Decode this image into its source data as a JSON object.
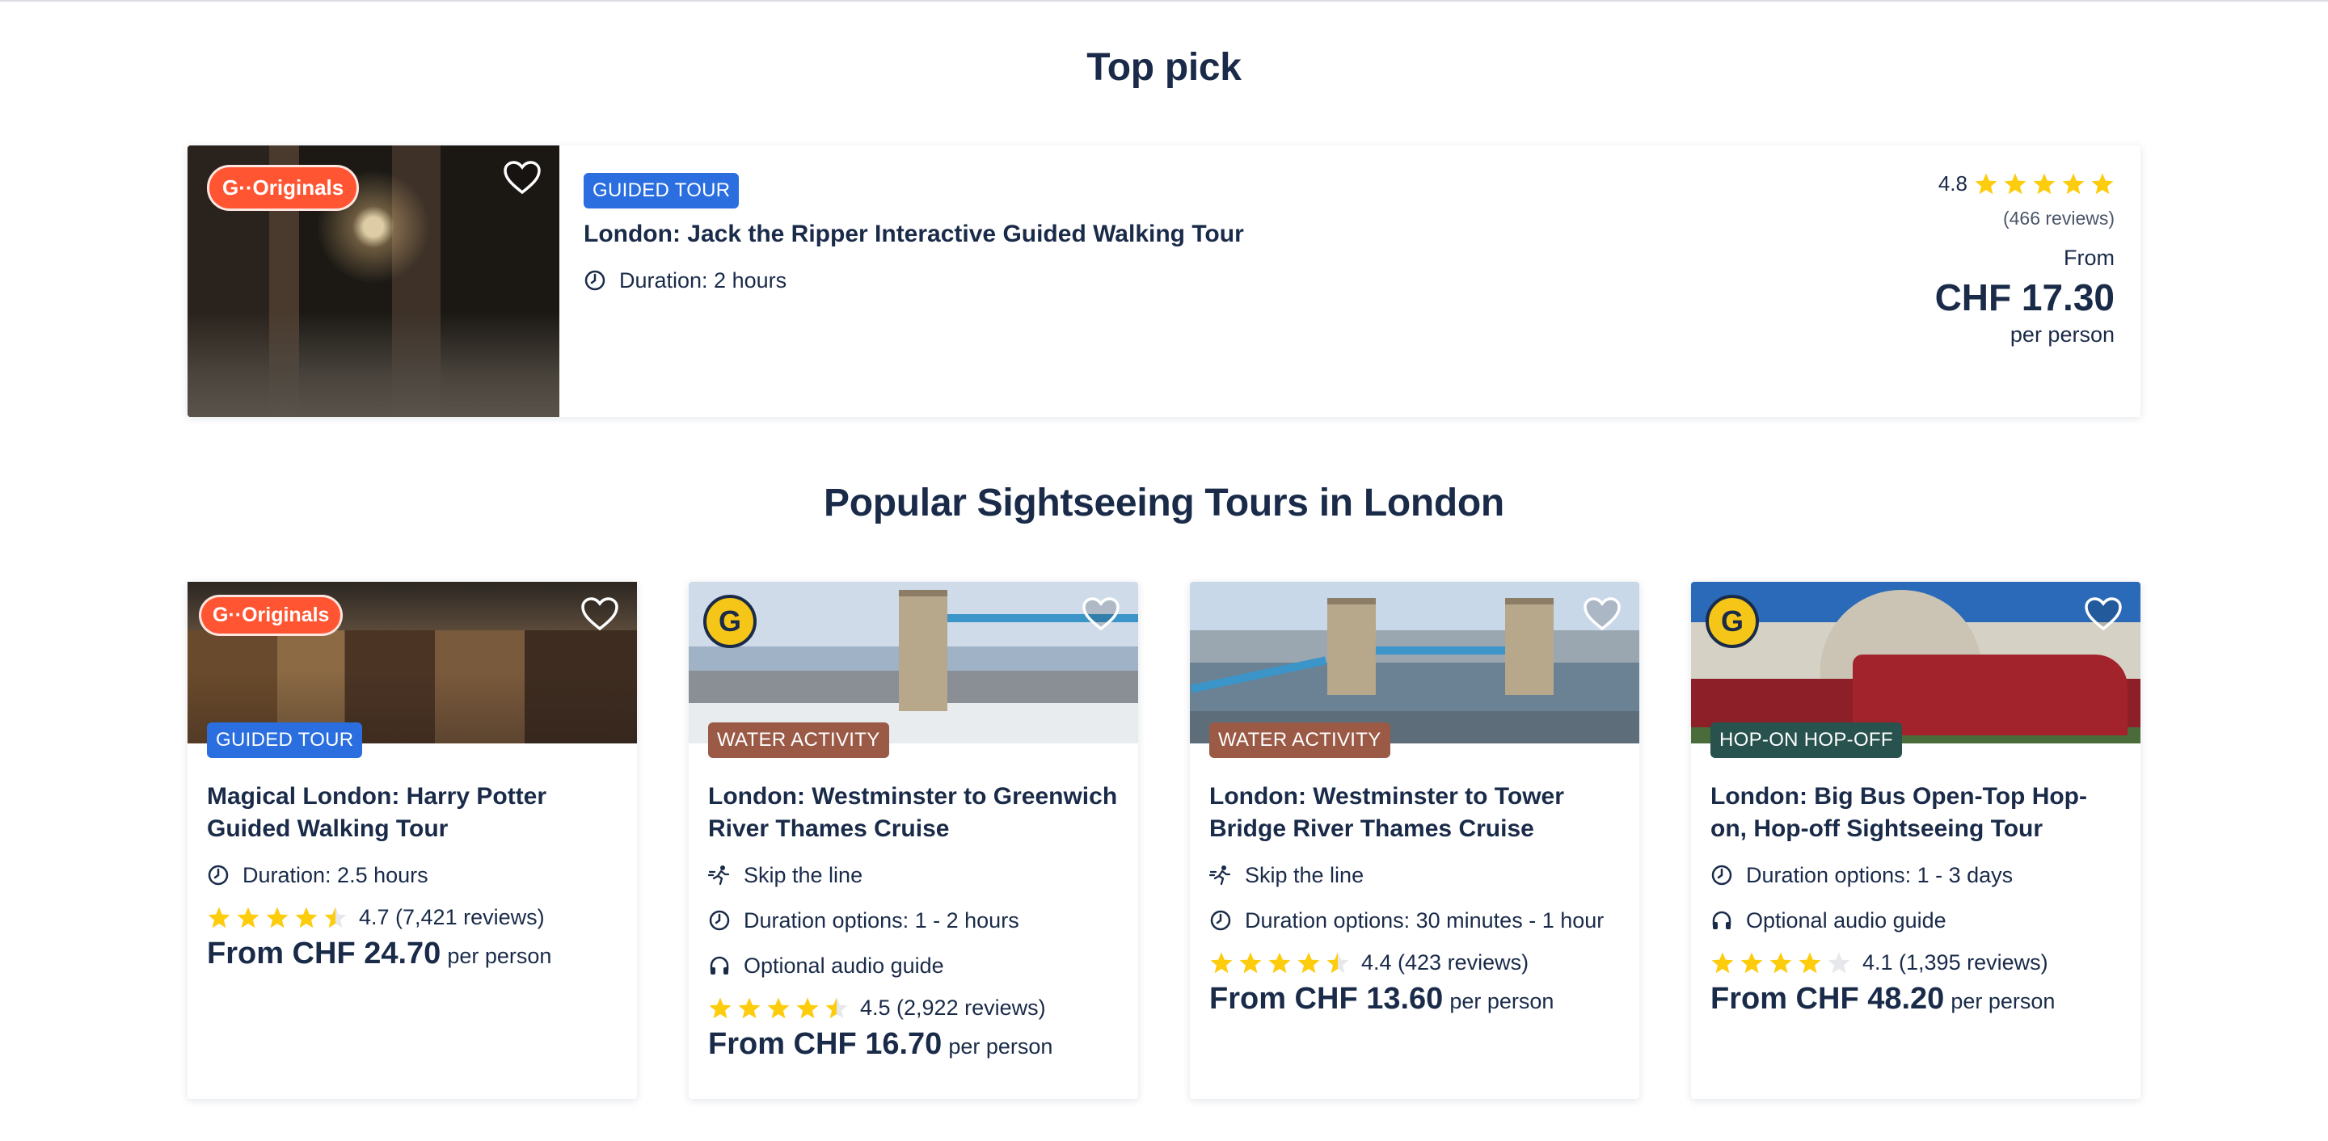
{
  "sections": {
    "top_pick_title": "Top pick",
    "popular_title": "Popular Sightseeing Tours in London"
  },
  "colors": {
    "text": "#1a2b49",
    "originals_badge": "#ff5533",
    "guided_tour": "#2a6ee0",
    "water_activity": "#9a5a46",
    "hop_on_hop_off": "#27524e",
    "star": "#fdcc0d"
  },
  "top_pick": {
    "originals_badge": "G··Originals",
    "category": "GUIDED TOUR",
    "title": "London: Jack the Ripper Interactive Guided Walking Tour",
    "duration_icon": "clock-icon",
    "duration": "Duration: 2 hours",
    "rating": "4.8",
    "stars": 5,
    "reviews": "(466 reviews)",
    "from_label": "From",
    "price": "CHF 17.30",
    "per_person": "per person"
  },
  "cards": [
    {
      "badge": "G··Originals",
      "category": "GUIDED TOUR",
      "title": "Magical London: Harry Potter Guided Walking Tour",
      "features": [
        {
          "icon": "clock-icon",
          "text": "Duration: 2.5 hours"
        }
      ],
      "stars": 4.5,
      "rating_text": "4.7 (7,421 reviews)",
      "price": "From CHF 24.70",
      "per_person": "per person"
    },
    {
      "badge": "G",
      "category": "WATER ACTIVITY",
      "title": "London: Westminster to Greenwich River Thames Cruise",
      "features": [
        {
          "icon": "skip-line-icon",
          "text": "Skip the line"
        },
        {
          "icon": "clock-icon",
          "text": "Duration options: 1 - 2 hours"
        },
        {
          "icon": "headphones-icon",
          "text": "Optional audio guide"
        }
      ],
      "stars": 4.5,
      "rating_text": "4.5 (2,922 reviews)",
      "price": "From CHF 16.70",
      "per_person": "per person"
    },
    {
      "badge": "",
      "category": "WATER ACTIVITY",
      "title": "London: Westminster to Tower Bridge River Thames Cruise",
      "features": [
        {
          "icon": "skip-line-icon",
          "text": "Skip the line"
        },
        {
          "icon": "clock-icon",
          "text": "Duration options: 30 minutes - 1 hour"
        }
      ],
      "stars": 4.5,
      "rating_text": "4.4 (423 reviews)",
      "price": "From CHF 13.60",
      "per_person": "per person"
    },
    {
      "badge": "G",
      "category": "HOP-ON HOP-OFF",
      "title": "London: Big Bus Open-Top Hop-on, Hop-off Sightseeing Tour",
      "features": [
        {
          "icon": "clock-icon",
          "text": "Duration options: 1 - 3 days"
        },
        {
          "icon": "headphones-icon",
          "text": "Optional audio guide"
        }
      ],
      "stars": 4,
      "rating_text": "4.1 (1,395 reviews)",
      "price": "From CHF 48.20",
      "per_person": "per person"
    }
  ]
}
